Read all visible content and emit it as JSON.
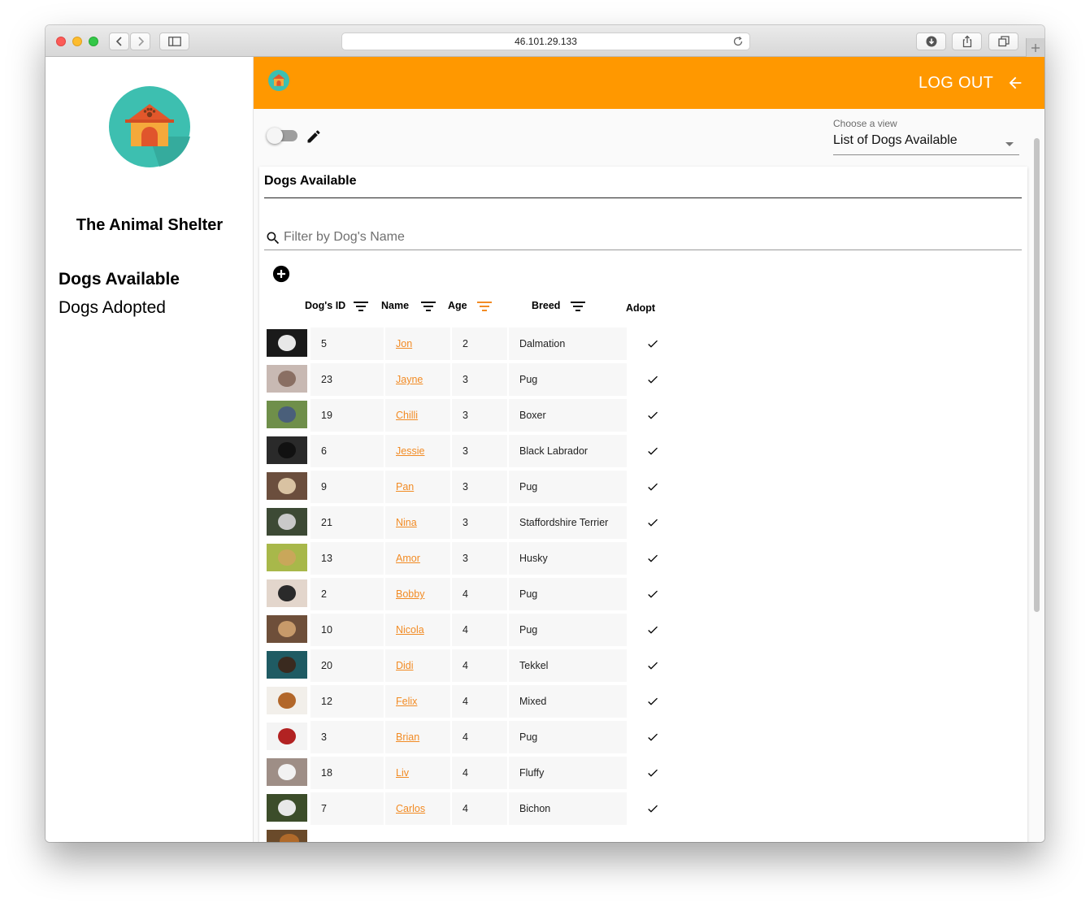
{
  "browser": {
    "url": "46.101.29.133"
  },
  "sidebar": {
    "title": "The Animal Shelter",
    "nav": [
      {
        "label": "Dogs Available",
        "active": true
      },
      {
        "label": "Dogs Adopted",
        "active": false
      }
    ]
  },
  "appbar": {
    "logout_label": "LOG OUT",
    "accent_color": "#ff9800"
  },
  "view_select": {
    "label": "Choose a view",
    "value": "List of Dogs Available"
  },
  "table": {
    "title": "Dogs Available",
    "search_placeholder": "Filter by Dog's Name",
    "columns": {
      "id": "Dog's ID",
      "name": "Name",
      "age": "Age",
      "breed": "Breed",
      "adopt": "Adopt"
    },
    "active_sort_column": "Age",
    "rows": [
      {
        "id": "5",
        "name": "Jon",
        "age": "2",
        "breed": "Dalmation"
      },
      {
        "id": "23",
        "name": "Jayne",
        "age": "3",
        "breed": "Pug"
      },
      {
        "id": "19",
        "name": "Chilli",
        "age": "3",
        "breed": "Boxer"
      },
      {
        "id": "6",
        "name": "Jessie",
        "age": "3",
        "breed": "Black Labrador"
      },
      {
        "id": "9",
        "name": "Pan",
        "age": "3",
        "breed": "Pug"
      },
      {
        "id": "21",
        "name": "Nina",
        "age": "3",
        "breed": "Staffordshire Terrier"
      },
      {
        "id": "13",
        "name": "Amor",
        "age": "3",
        "breed": "Husky"
      },
      {
        "id": "2",
        "name": "Bobby",
        "age": "4",
        "breed": "Pug"
      },
      {
        "id": "10",
        "name": "Nicola",
        "age": "4",
        "breed": "Pug"
      },
      {
        "id": "20",
        "name": "Didi",
        "age": "4",
        "breed": "Tekkel"
      },
      {
        "id": "12",
        "name": "Felix",
        "age": "4",
        "breed": "Mixed"
      },
      {
        "id": "3",
        "name": "Brian",
        "age": "4",
        "breed": "Pug"
      },
      {
        "id": "18",
        "name": "Liv",
        "age": "4",
        "breed": "Fluffy"
      },
      {
        "id": "7",
        "name": "Carlos",
        "age": "4",
        "breed": "Bichon"
      }
    ]
  }
}
